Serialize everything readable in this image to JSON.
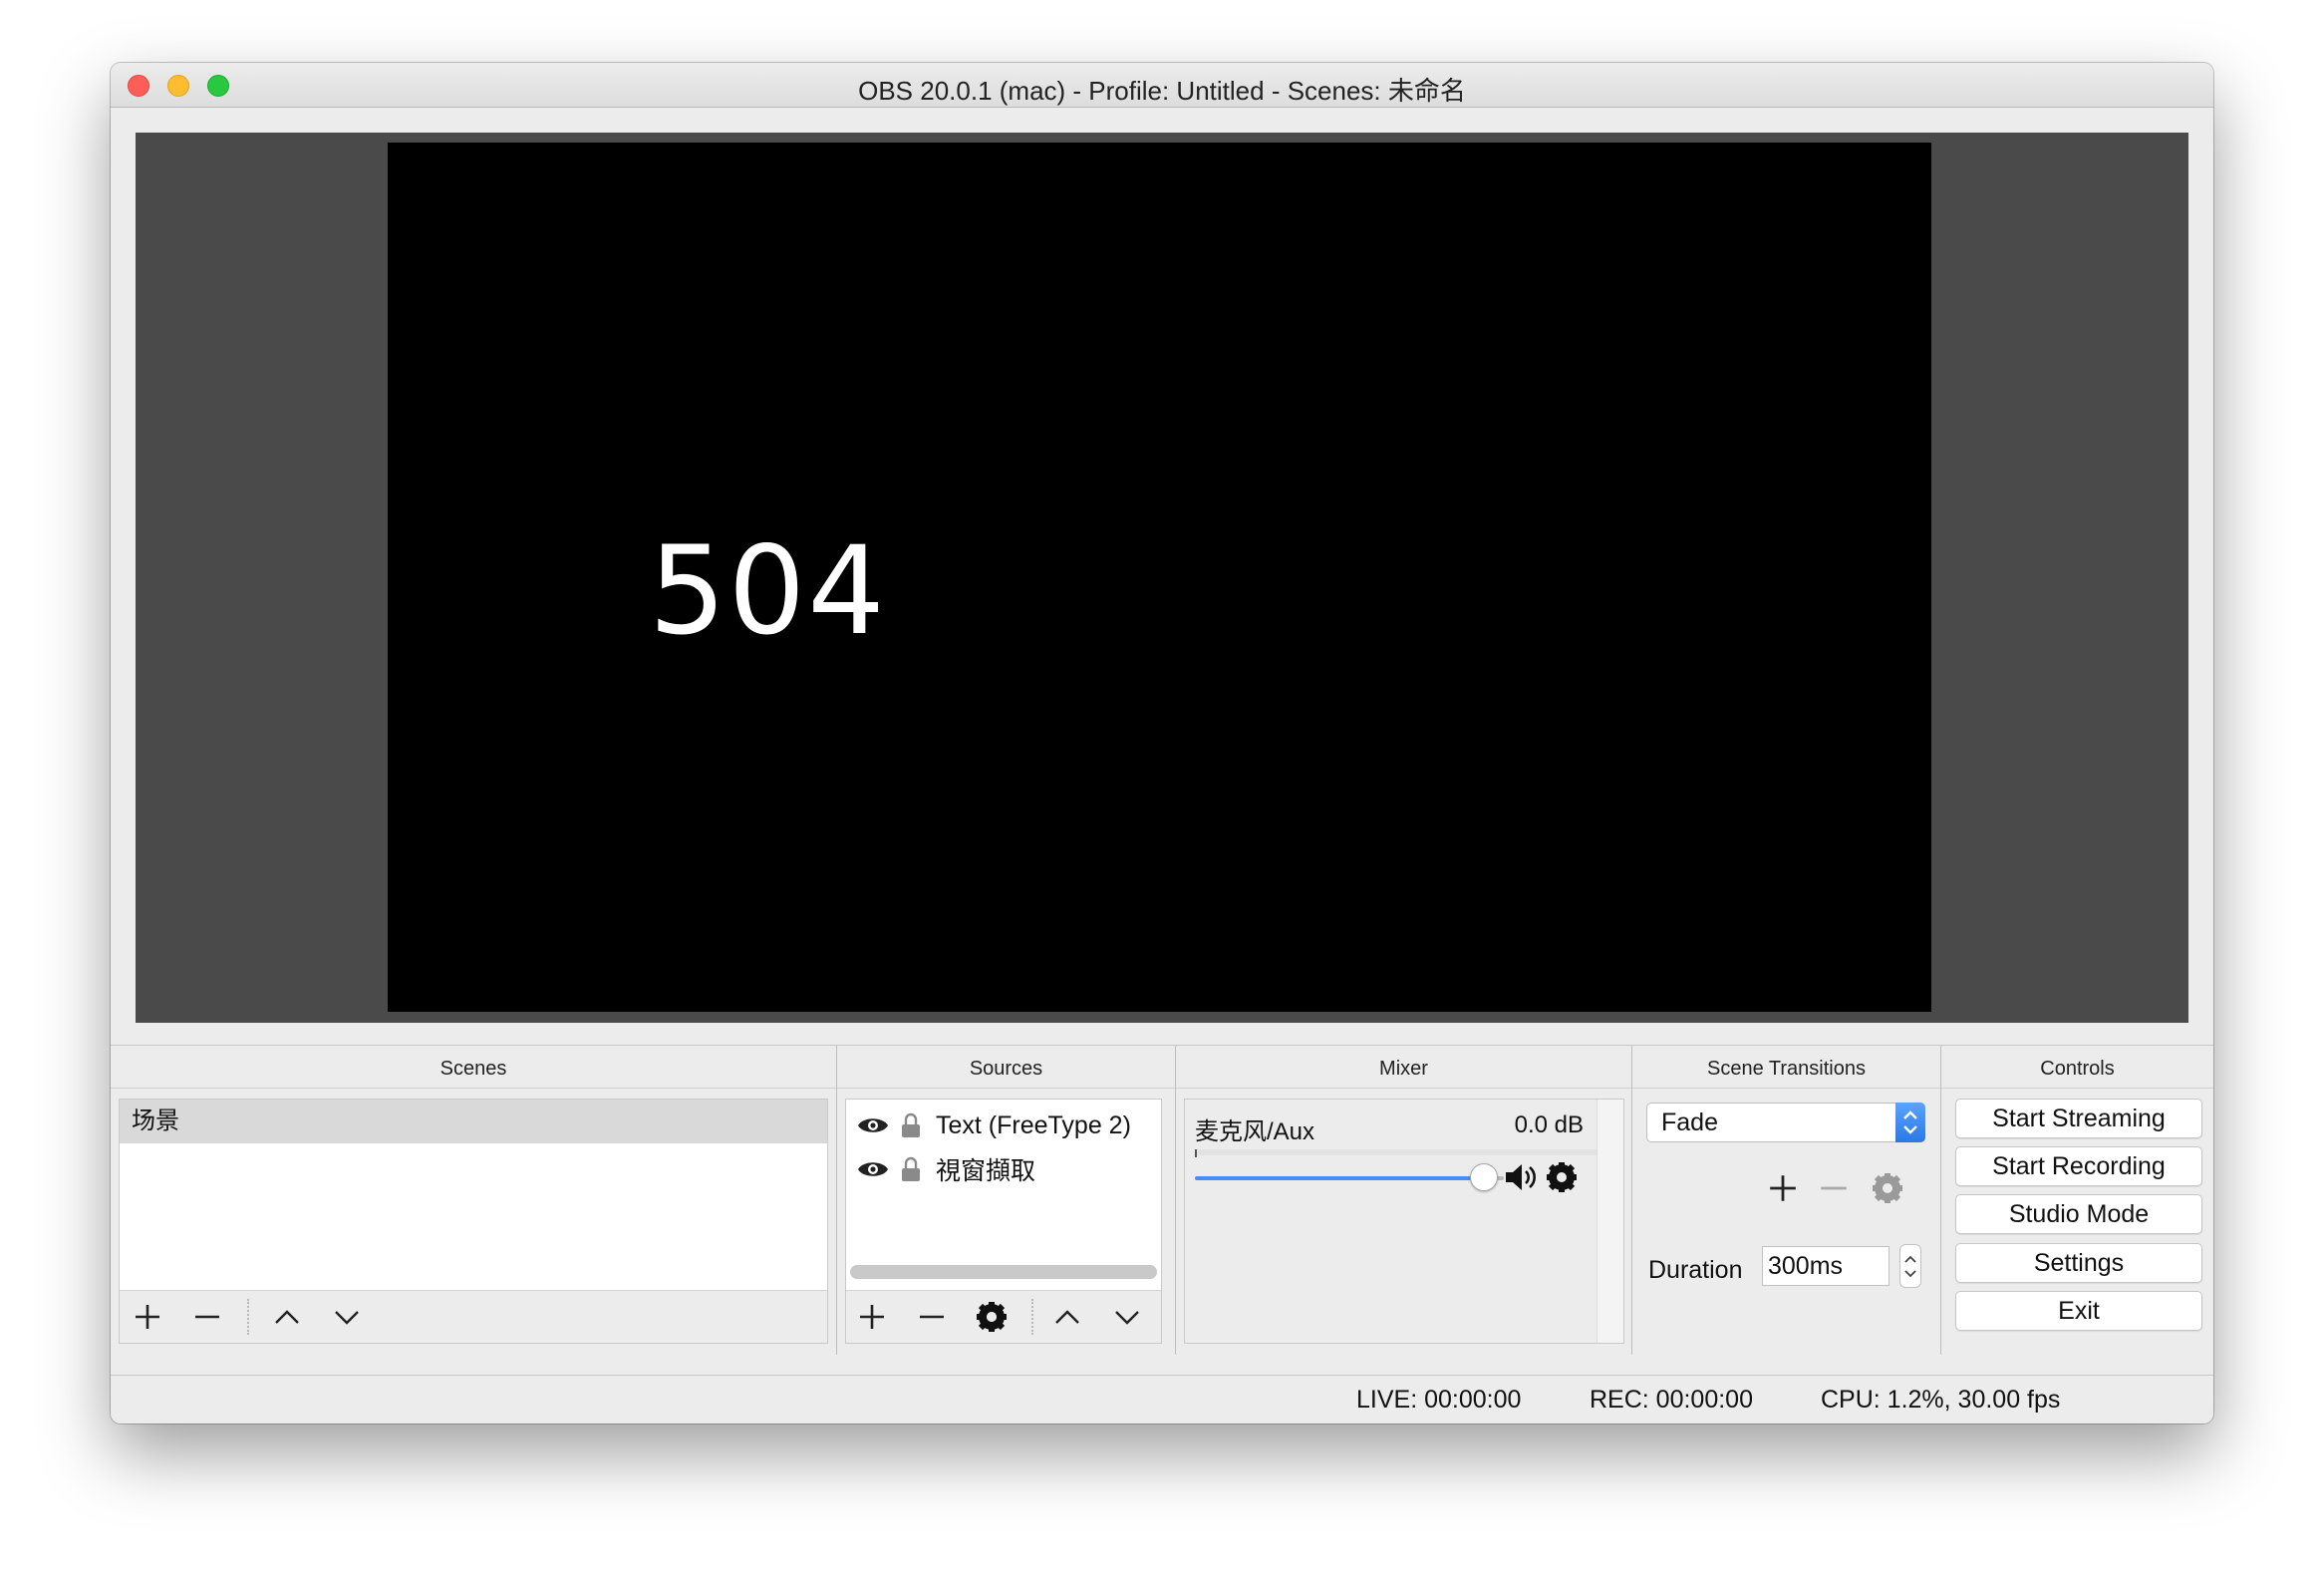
{
  "window": {
    "title": "OBS 20.0.1 (mac) - Profile: Untitled - Scenes: 未命名"
  },
  "preview": {
    "canvas_text": "504"
  },
  "docks": {
    "scenes": {
      "title": "Scenes",
      "items": [
        "场景"
      ],
      "selected": "场景"
    },
    "sources": {
      "title": "Sources",
      "items": [
        {
          "label": "Text (FreeType 2)",
          "visible": true,
          "locked": false
        },
        {
          "label": "視窗擷取",
          "visible": true,
          "locked": false
        }
      ]
    },
    "mixer": {
      "title": "Mixer",
      "channels": [
        {
          "label": "麦克风/Aux",
          "db": "0.0 dB",
          "volume_level": 1.0
        }
      ]
    },
    "transitions": {
      "title": "Scene Transitions",
      "selected": "Fade",
      "duration_label": "Duration",
      "duration_value": "300ms"
    },
    "controls": {
      "title": "Controls",
      "buttons": {
        "start_streaming": "Start Streaming",
        "start_recording": "Start Recording",
        "studio_mode": "Studio Mode",
        "settings": "Settings",
        "exit": "Exit"
      }
    }
  },
  "status": {
    "live": "LIVE: 00:00:00",
    "rec": "REC: 00:00:00",
    "cpu": "CPU: 1.2%, 30.00 fps"
  },
  "colors": {
    "accent_blue": "#4a8cf5",
    "close": "#fd5f57",
    "minimize": "#febc2e",
    "maximize": "#28c840"
  }
}
